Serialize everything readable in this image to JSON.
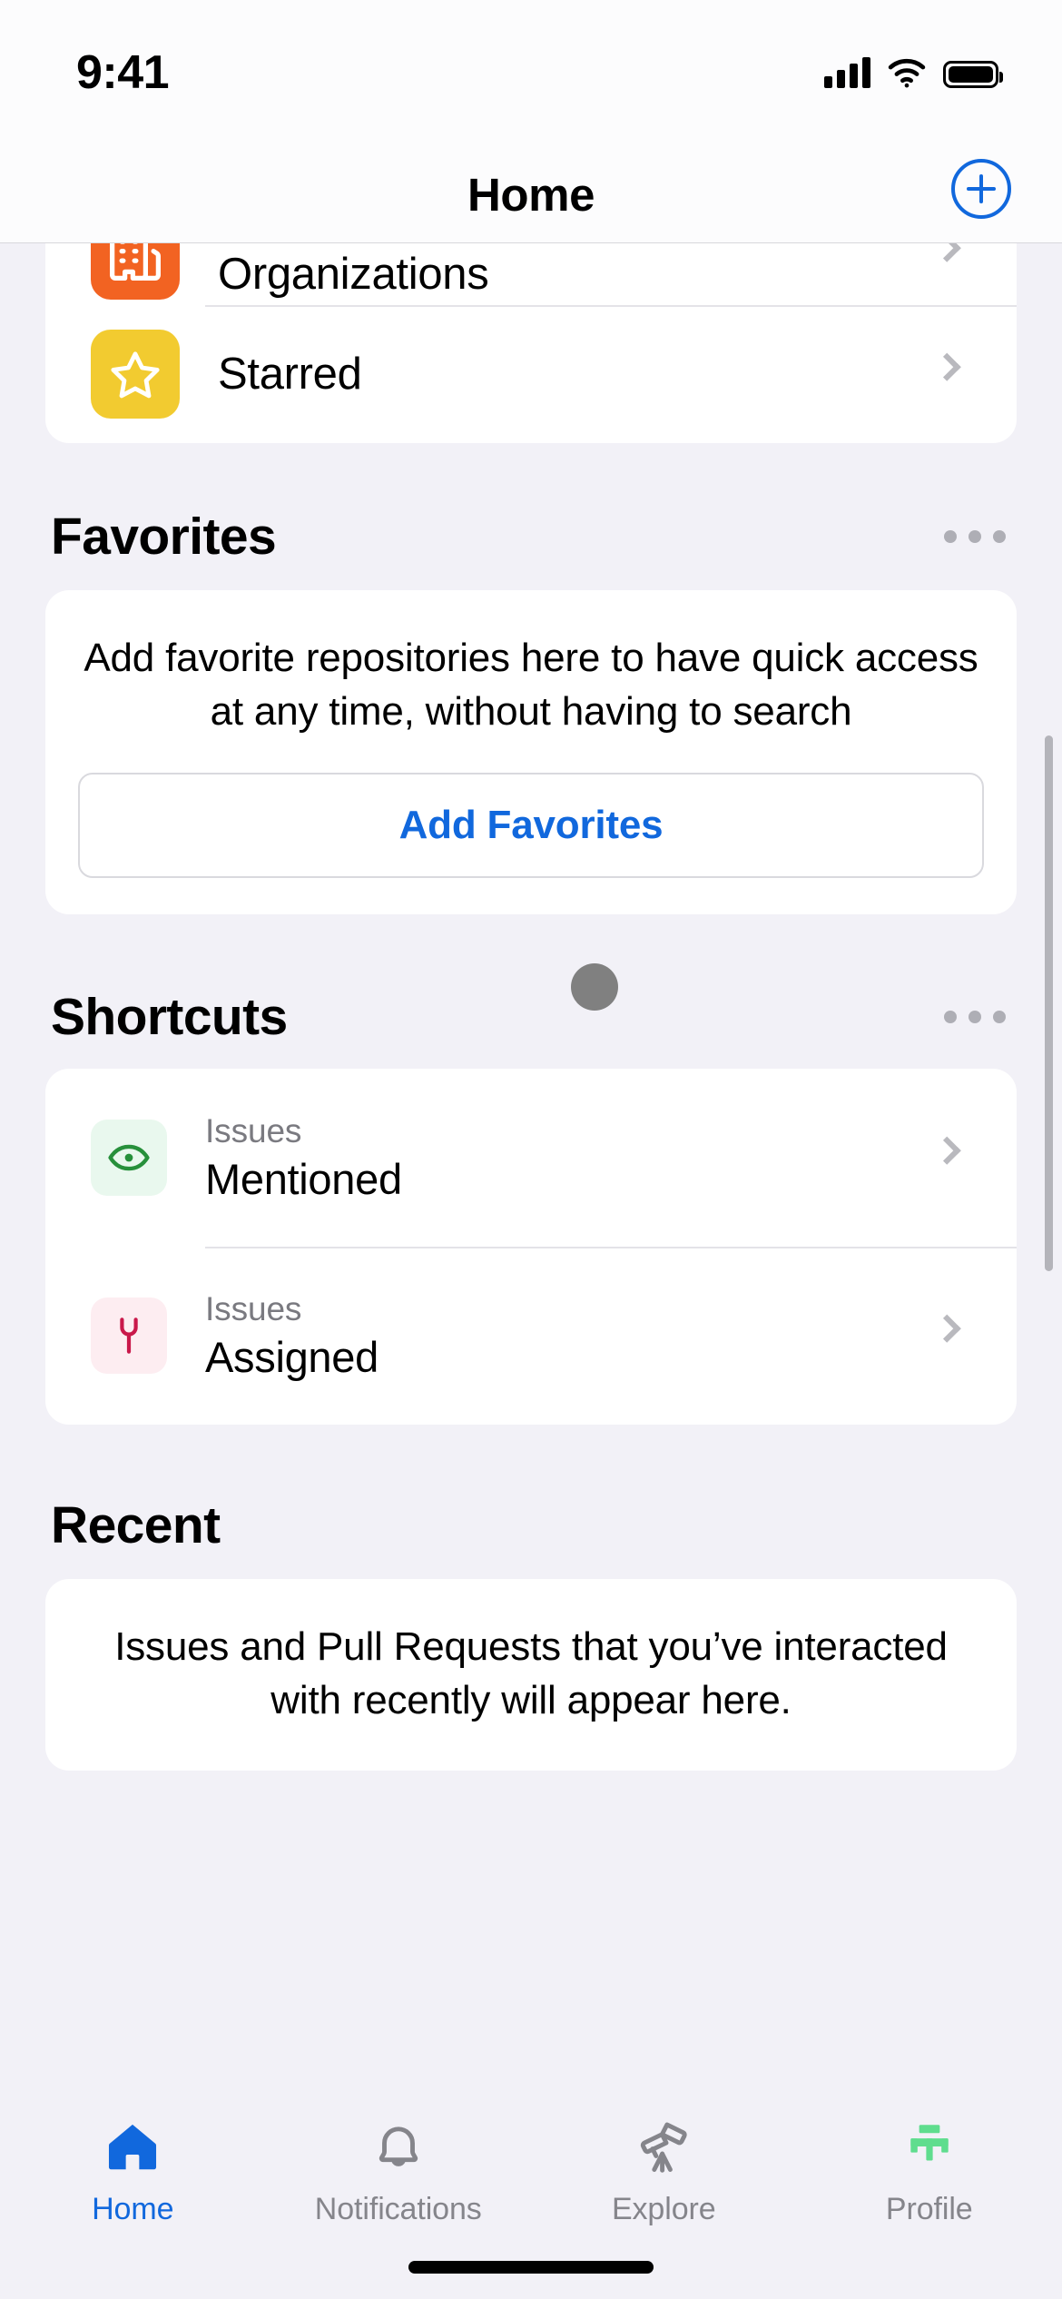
{
  "status_bar": {
    "time": "9:41",
    "cellular_icon": "cellular-bars-icon",
    "wifi_icon": "wifi-icon",
    "battery_icon": "battery-full-icon"
  },
  "nav_bar": {
    "title": "Home",
    "add_button_icon": "plus-circle-icon"
  },
  "top_list": {
    "items": [
      {
        "label": "Organizations",
        "icon": "organization-icon",
        "icon_bg": "#F26322"
      },
      {
        "label": "Starred",
        "icon": "star-icon",
        "icon_bg": "#F2CB30"
      }
    ]
  },
  "favorites": {
    "title": "Favorites",
    "menu_icon": "ellipsis-icon",
    "empty_text": "Add favorite repositories here to have quick access at any time, without having to search",
    "action_label": "Add Favorites"
  },
  "shortcuts": {
    "title": "Shortcuts",
    "menu_icon": "ellipsis-icon",
    "items": [
      {
        "subtitle": "Issues",
        "title": "Mentioned",
        "icon": "eye-icon",
        "icon_bg": "#E9F8EE",
        "icon_color": "#27903B"
      },
      {
        "subtitle": "Issues",
        "title": "Assigned",
        "icon": "wrench-icon",
        "icon_bg": "#FDEDF1",
        "icon_color": "#C9184A"
      }
    ]
  },
  "recent": {
    "title": "Recent",
    "empty_text": "Issues and Pull Requests that you’ve interacted with recently will appear here."
  },
  "tab_bar": {
    "tabs": [
      {
        "label": "Home",
        "icon": "home-icon",
        "active": true
      },
      {
        "label": "Notifications",
        "icon": "bell-icon",
        "active": false
      },
      {
        "label": "Explore",
        "icon": "telescope-icon",
        "active": false
      },
      {
        "label": "Profile",
        "icon": "profile-avatar-icon",
        "active": false
      }
    ]
  },
  "colors": {
    "accent_blue": "#1168DD",
    "background": "#F2F1F7",
    "card": "#FFFFFF",
    "inactive_gray": "#85858B",
    "profile_green": "#5FDD8E"
  },
  "cursor": {
    "visible": true
  }
}
